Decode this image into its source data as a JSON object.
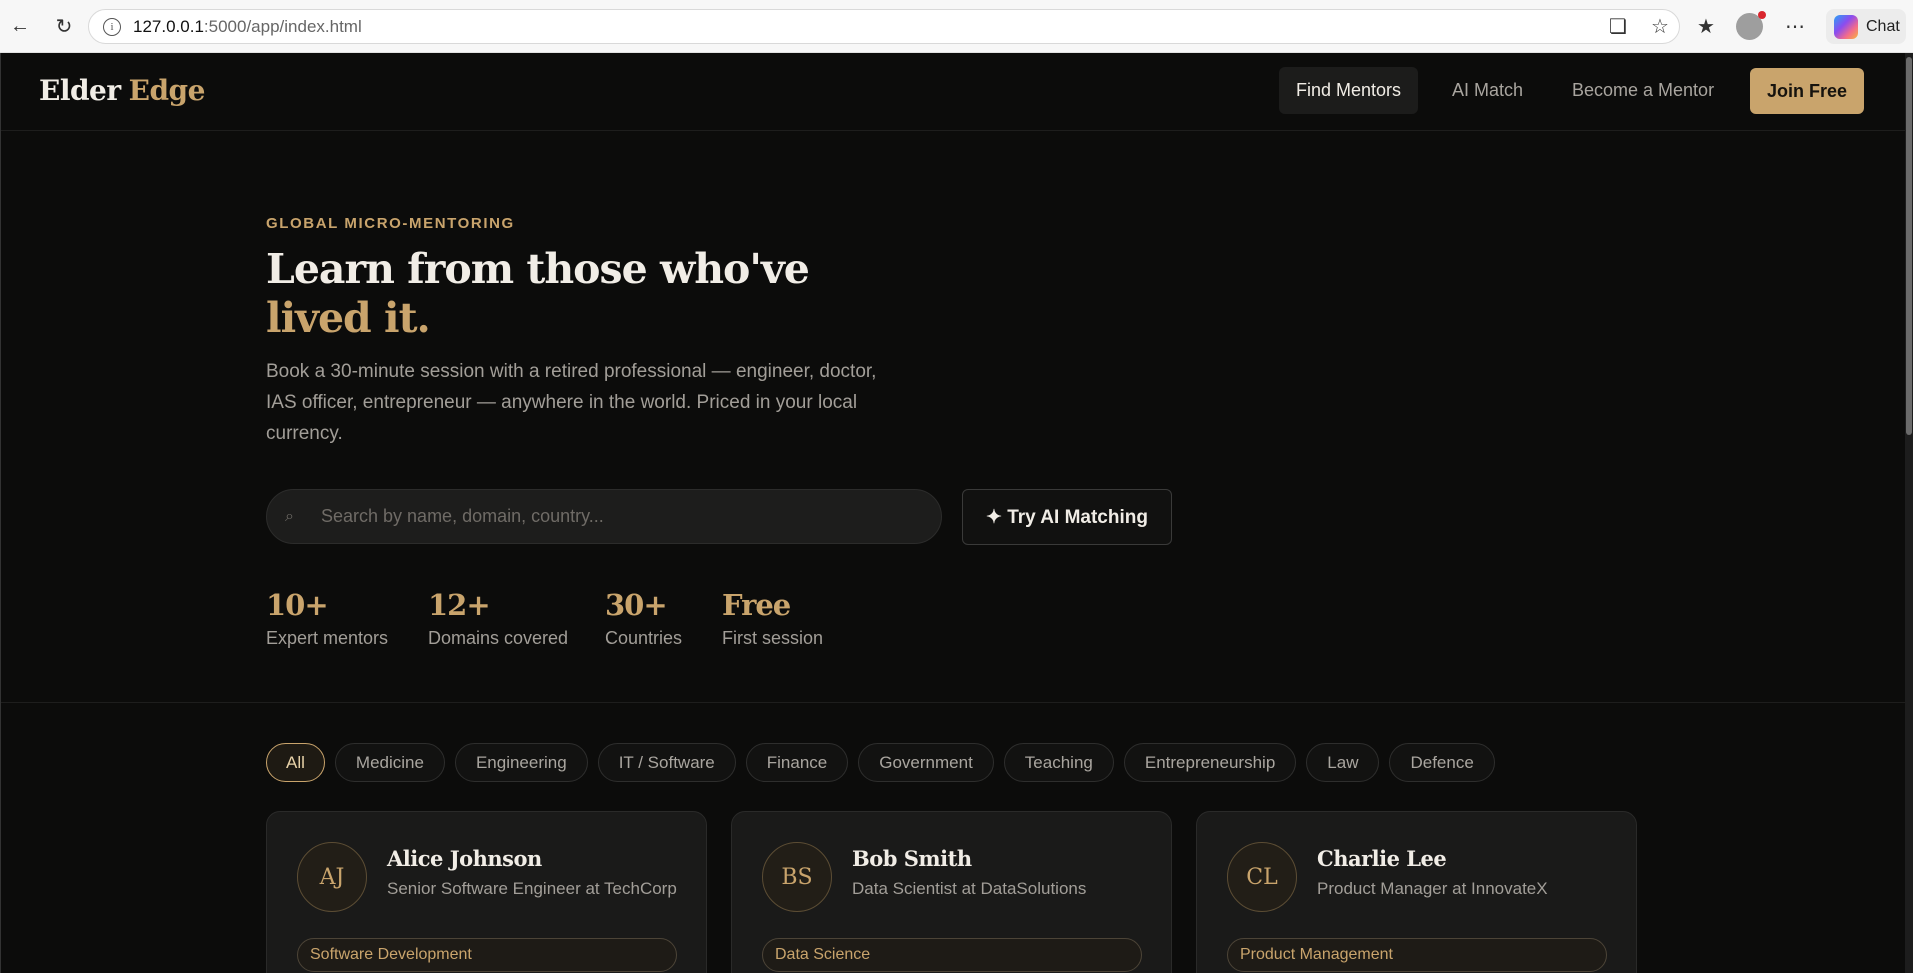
{
  "browser": {
    "url_host": "127.0.0.1",
    "url_path": ":5000/app/index.html",
    "chat_label": "Chat"
  },
  "nav": {
    "logo_primary": "Elder",
    "logo_accent": "Edge",
    "links": [
      "Find Mentors",
      "AI Match",
      "Become a Mentor"
    ],
    "active_link": "Find Mentors",
    "cta": "Join Free"
  },
  "hero": {
    "eyebrow": "GLOBAL MICRO-MENTORING",
    "title_line1": "Learn from those who've",
    "title_line2": "lived it.",
    "subtitle": "Book a 30-minute session with a retired professional — engineer, doctor, IAS officer, entrepreneur — anywhere in the world. Priced in your local currency.",
    "search_placeholder": "Search by name, domain, country...",
    "ai_button": "✦ Try AI Matching"
  },
  "stats": [
    {
      "value": "10+",
      "label": "Expert mentors"
    },
    {
      "value": "12+",
      "label": "Domains covered"
    },
    {
      "value": "30+",
      "label": "Countries"
    },
    {
      "value": "Free",
      "label": "First session"
    }
  ],
  "filters": {
    "active": "All",
    "items": [
      "All",
      "Medicine",
      "Engineering",
      "IT / Software",
      "Finance",
      "Government",
      "Teaching",
      "Entrepreneurship",
      "Law",
      "Defence"
    ]
  },
  "mentors": [
    {
      "initials": "AJ",
      "name": "Alice Johnson",
      "role": "Senior Software Engineer at TechCorp",
      "tag": "Software Development"
    },
    {
      "initials": "BS",
      "name": "Bob Smith",
      "role": "Data Scientist at DataSolutions",
      "tag": "Data Science"
    },
    {
      "initials": "CL",
      "name": "Charlie Lee",
      "role": "Product Manager at InnovateX",
      "tag": "Product Management"
    }
  ],
  "colors": {
    "background": "#0c0c0b",
    "accent_gold": "#c9a46c",
    "text_primary": "#f1ede6",
    "text_muted": "#a29e98"
  }
}
